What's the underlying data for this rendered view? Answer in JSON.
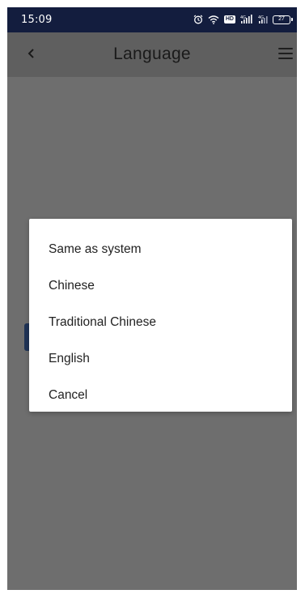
{
  "status_bar": {
    "time": "15:09",
    "battery": "27",
    "icons": [
      "alarm-icon",
      "wifi-icon",
      "hd-icon",
      "signal-4g-icon",
      "signal-4g-2-icon",
      "battery-icon"
    ],
    "hd_label": "HD",
    "net1": "4G",
    "net2": "4G"
  },
  "header": {
    "back_icon": "chevron-left-icon",
    "title": "Language",
    "menu_icon": "hamburger-menu-icon"
  },
  "dialog": {
    "options": [
      {
        "label": "Same as system"
      },
      {
        "label": "Chinese"
      },
      {
        "label": "Traditional Chinese"
      },
      {
        "label": "English"
      },
      {
        "label": "Cancel"
      }
    ]
  },
  "colors": {
    "status_bar_bg": "#131d3e",
    "overlay": "#6e6e6e",
    "accent_button": "#1f3356",
    "dialog_bg": "#ffffff"
  }
}
